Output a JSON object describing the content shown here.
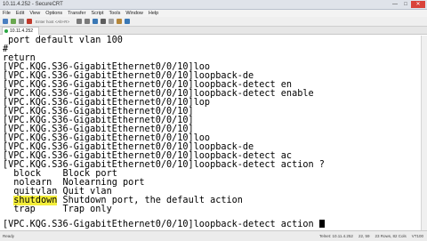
{
  "window": {
    "title": "10.11.4.252 - SecureCRT",
    "min_label": "—",
    "max_label": "□",
    "close_label": "✕"
  },
  "menu": [
    "File",
    "Edit",
    "View",
    "Options",
    "Transfer",
    "Script",
    "Tools",
    "Window",
    "Help"
  ],
  "toolbar": {
    "host_placeholder": "Enter host <Alt+R>",
    "icons": [
      "connect-icon",
      "quick-connect-icon",
      "reconnect-icon",
      "disconnect-icon",
      "copy-icon",
      "paste-icon",
      "find-icon",
      "print-icon",
      "settings-icon",
      "keymap-icon",
      "help-icon"
    ]
  },
  "tab": {
    "label": "10.11.4.252"
  },
  "terminal": {
    "lines": [
      " port default vlan 100",
      "#",
      "return",
      "[VPC.KQG.S36-GigabitEthernet0/0/10]loo",
      "[VPC.KQG.S36-GigabitEthernet0/0/10]loopback-de",
      "[VPC.KQG.S36-GigabitEthernet0/0/10]loopback-detect en",
      "[VPC.KQG.S36-GigabitEthernet0/0/10]loopback-detect enable",
      "[VPC.KQG.S36-GigabitEthernet0/0/10]lop",
      "[VPC.KQG.S36-GigabitEthernet0/0/10]",
      "[VPC.KQG.S36-GigabitEthernet0/0/10]",
      "[VPC.KQG.S36-GigabitEthernet0/0/10]",
      "[VPC.KQG.S36-GigabitEthernet0/0/10]loo",
      "[VPC.KQG.S36-GigabitEthernet0/0/10]loopback-de",
      "[VPC.KQG.S36-GigabitEthernet0/0/10]loopback-detect ac",
      "[VPC.KQG.S36-GigabitEthernet0/0/10]loopback-detect action ?"
    ],
    "options": [
      {
        "cmd": "block",
        "desc": "Block port"
      },
      {
        "cmd": "nolearn",
        "desc": "Nolearning port"
      },
      {
        "cmd": "quitvlan",
        "desc": "Quit vlan"
      },
      {
        "cmd": "shutdown",
        "desc": "Shutdown port, the default action"
      },
      {
        "cmd": "trap",
        "desc": "Trap only"
      }
    ],
    "highlighted_command": "shutdown",
    "prompt_line": "[VPC.KQG.S36-GigabitEthernet0/0/10]loopback-detect action ",
    "highlight_color": "#f4ee3a"
  },
  "status": {
    "left": "Ready",
    "session": "Telnet: 10.11.4.252",
    "position": "22, 59",
    "size": "23 Rows, 82 Cols",
    "emulation": "VT100"
  }
}
